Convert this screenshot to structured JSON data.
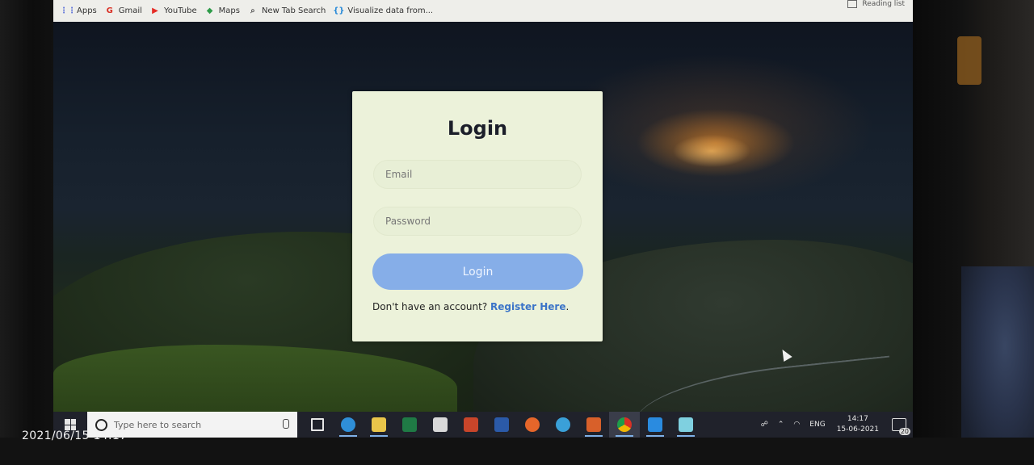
{
  "bookmarks": [
    {
      "label": "Apps",
      "icon": "apps-grid-icon",
      "color": "#5a6fd8"
    },
    {
      "label": "Gmail",
      "icon": "google-g-icon",
      "color": "#d93025"
    },
    {
      "label": "YouTube",
      "icon": "youtube-icon",
      "color": "#e52d27"
    },
    {
      "label": "Maps",
      "icon": "maps-icon",
      "color": "#2d9b48"
    },
    {
      "label": "New Tab Search",
      "icon": "search-icon",
      "color": "#555555"
    },
    {
      "label": "Visualize data from...",
      "icon": "brackets-icon",
      "color": "#2a8bd8"
    }
  ],
  "reading_list": {
    "label": "Reading list"
  },
  "login": {
    "title": "Login",
    "email_placeholder": "Email",
    "password_placeholder": "Password",
    "button_label": "Login",
    "register_prompt": "Don't have an account?",
    "register_link": "Register Here",
    "register_suffix": ".",
    "card_color": "#ecf2da",
    "button_color": "#86aee8",
    "link_color": "#3b74c8"
  },
  "taskbar": {
    "search_placeholder": "Type here to search",
    "apps": [
      {
        "icon": "task-view-icon",
        "color": "#e6e6e6",
        "active": false
      },
      {
        "icon": "edge-icon",
        "color": "#2f8fd8",
        "active": true
      },
      {
        "icon": "file-explorer-icon",
        "color": "#e9c54a",
        "active": true
      },
      {
        "icon": "excel-icon",
        "color": "#1f7a45",
        "active": false
      },
      {
        "icon": "store-icon",
        "color": "#d9d9d9",
        "active": false
      },
      {
        "icon": "powerpoint-icon",
        "color": "#c8452a",
        "active": false
      },
      {
        "icon": "word-icon",
        "color": "#2b5aa8",
        "active": false
      },
      {
        "icon": "firefox-icon",
        "color": "#e5662a",
        "active": false
      },
      {
        "icon": "app-blue-icon",
        "color": "#3aa0d8",
        "active": false
      },
      {
        "icon": "xampp-icon",
        "color": "#d8602a",
        "active": true
      },
      {
        "icon": "chrome-icon",
        "color": "#e0a030",
        "active": true
      },
      {
        "icon": "vscode-icon",
        "color": "#2a8be0",
        "active": true
      },
      {
        "icon": "notepad-icon",
        "color": "#7fd0e0",
        "active": true
      }
    ],
    "language": "ENG",
    "time": "14:17",
    "date": "15-06-2021",
    "notifications": "20"
  },
  "photo_timestamp": "2021/06/15 14:17"
}
